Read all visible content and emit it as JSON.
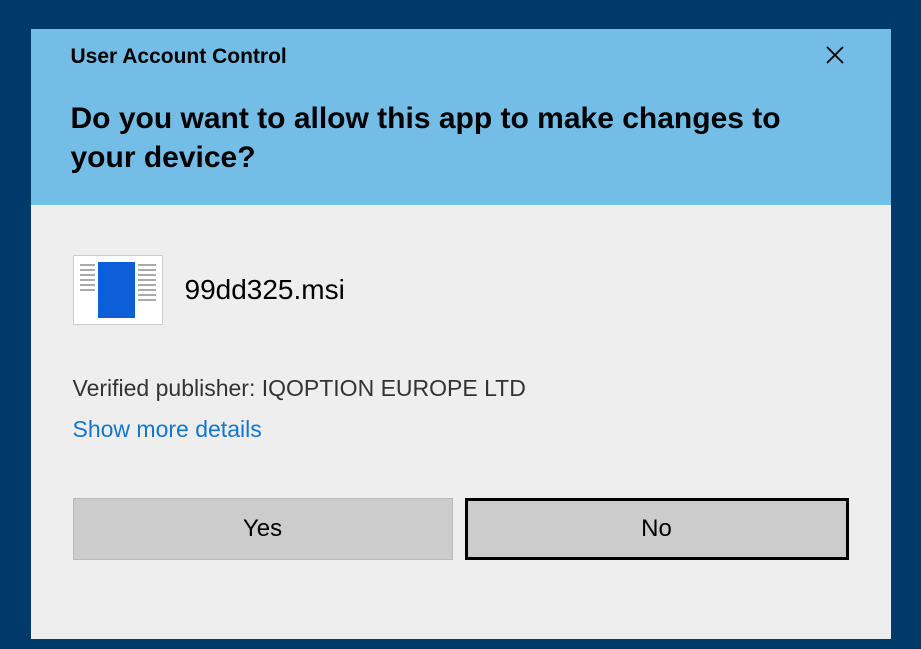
{
  "header": {
    "title": "User Account Control",
    "question": "Do you want to allow this app to make changes to your device?"
  },
  "app": {
    "filename": "99dd325.msi"
  },
  "publisher": {
    "label": "Verified publisher: ",
    "name": "IQOPTION EUROPE LTD"
  },
  "details_link": "Show more details",
  "buttons": {
    "yes": "Yes",
    "no": "No"
  }
}
